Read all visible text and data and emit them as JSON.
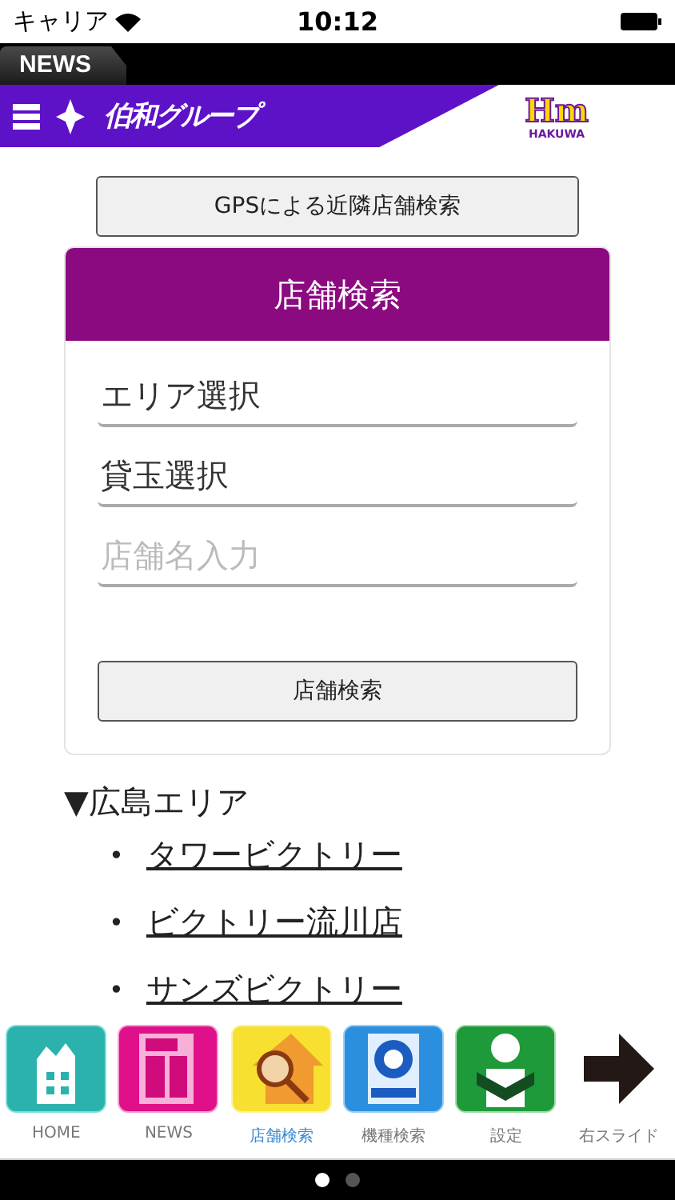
{
  "status_bar": {
    "carrier": "キャリア",
    "time": "10:12"
  },
  "news_tab": "NEWS",
  "header": {
    "brand": "伯和グループ",
    "logo_mark": "Hm",
    "logo_name": "HAKUWA"
  },
  "gps_button": "GPSによる近隣店舗検索",
  "search_card": {
    "title": "店舗検索",
    "fields": [
      {
        "kind": "select",
        "value": "エリア選択"
      },
      {
        "kind": "select",
        "value": "貸玉選択"
      },
      {
        "kind": "text",
        "placeholder": "店舗名入力"
      }
    ],
    "button": "店舗検索"
  },
  "area": {
    "heading": "▼広島エリア",
    "stores": [
      {
        "bullet": "•",
        "name": "タワービクトリー"
      },
      {
        "bullet": "•",
        "name": "ビクトリー流川店"
      },
      {
        "bullet": "•",
        "name": "サンズビクトリー"
      }
    ]
  },
  "tab_bar": [
    {
      "kind": "home",
      "label": "HOME",
      "selected": false
    },
    {
      "kind": "news",
      "label": "NEWS",
      "selected": false
    },
    {
      "kind": "shop",
      "label": "店舗検索",
      "selected": true
    },
    {
      "kind": "machine",
      "label": "機種検索",
      "selected": false
    },
    {
      "kind": "settings",
      "label": "設定",
      "selected": false
    },
    {
      "kind": "arrow",
      "label": "右スライド",
      "selected": false
    }
  ],
  "pages": [
    {
      "selected": true
    },
    {
      "selected": false
    }
  ]
}
